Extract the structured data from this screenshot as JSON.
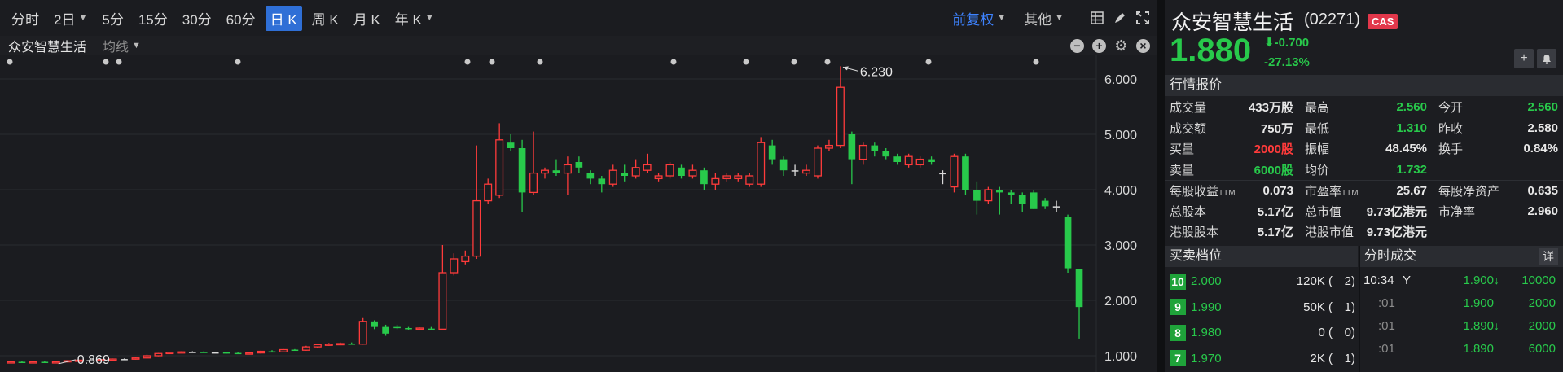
{
  "toolbar": {
    "periods": [
      {
        "label": "分时",
        "caret": false,
        "active": false
      },
      {
        "label": "2日",
        "caret": true,
        "active": false
      },
      {
        "label": "5分",
        "caret": false,
        "active": false
      },
      {
        "label": "15分",
        "caret": false,
        "active": false
      },
      {
        "label": "30分",
        "caret": false,
        "active": false
      },
      {
        "label": "60分",
        "caret": false,
        "active": false
      },
      {
        "label": "日 K",
        "caret": false,
        "active": true
      },
      {
        "label": "周 K",
        "caret": false,
        "active": false
      },
      {
        "label": "月 K",
        "caret": false,
        "active": false
      },
      {
        "label": "年 K",
        "caret": true,
        "active": false
      }
    ],
    "adjust_label": "前复权",
    "other_label": "其他",
    "icons": [
      "layout-grid-icon",
      "draw-pen-icon",
      "fullscreen-icon"
    ]
  },
  "series_bar": {
    "stock_name": "众安智慧生活",
    "ma_label": "均线",
    "icons": [
      "zoom-out-icon",
      "zoom-in-icon",
      "settings-icon",
      "close-icon"
    ]
  },
  "chart_data": {
    "type": "candlestick",
    "y_axis_labels": [
      "6.000",
      "5.000",
      "4.000",
      "3.000",
      "2.000",
      "1.000"
    ],
    "ylim": [
      0.9,
      6.3
    ],
    "max_label": "6.230",
    "min_label": "0.869",
    "colors": {
      "up": "#ff3b3b",
      "down": "#28c94b",
      "flat": "#d8d8d8"
    },
    "candles": [
      {
        "o": 0.88,
        "h": 0.9,
        "l": 0.87,
        "c": 0.89
      },
      {
        "o": 0.89,
        "h": 0.9,
        "l": 0.88,
        "c": 0.88
      },
      {
        "o": 0.88,
        "h": 0.89,
        "l": 0.87,
        "c": 0.89
      },
      {
        "o": 0.89,
        "h": 0.9,
        "l": 0.87,
        "c": 0.88
      },
      {
        "o": 0.88,
        "h": 0.89,
        "l": 0.869,
        "c": 0.89
      },
      {
        "o": 0.89,
        "h": 0.92,
        "l": 0.88,
        "c": 0.91
      },
      {
        "o": 0.91,
        "h": 0.93,
        "l": 0.9,
        "c": 0.92
      },
      {
        "o": 0.92,
        "h": 0.93,
        "l": 0.91,
        "c": 0.92
      },
      {
        "o": 0.92,
        "h": 0.94,
        "l": 0.91,
        "c": 0.93
      },
      {
        "o": 0.93,
        "h": 0.95,
        "l": 0.92,
        "c": 0.94
      },
      {
        "o": 0.94,
        "h": 0.95,
        "l": 0.93,
        "c": 0.94
      },
      {
        "o": 0.94,
        "h": 0.97,
        "l": 0.93,
        "c": 0.96
      },
      {
        "o": 0.96,
        "h": 1.02,
        "l": 0.95,
        "c": 1.0
      },
      {
        "o": 1.0,
        "h": 1.05,
        "l": 0.99,
        "c": 1.04
      },
      {
        "o": 1.04,
        "h": 1.07,
        "l": 1.03,
        "c": 1.06
      },
      {
        "o": 1.06,
        "h": 1.08,
        "l": 1.05,
        "c": 1.07
      },
      {
        "o": 1.07,
        "h": 1.08,
        "l": 1.06,
        "c": 1.07
      },
      {
        "o": 1.07,
        "h": 1.08,
        "l": 1.05,
        "c": 1.06
      },
      {
        "o": 1.06,
        "h": 1.07,
        "l": 1.05,
        "c": 1.06
      },
      {
        "o": 1.06,
        "h": 1.07,
        "l": 1.04,
        "c": 1.05
      },
      {
        "o": 1.05,
        "h": 1.06,
        "l": 1.03,
        "c": 1.04
      },
      {
        "o": 1.04,
        "h": 1.06,
        "l": 1.03,
        "c": 1.05
      },
      {
        "o": 1.05,
        "h": 1.09,
        "l": 1.04,
        "c": 1.08
      },
      {
        "o": 1.08,
        "h": 1.1,
        "l": 1.06,
        "c": 1.07
      },
      {
        "o": 1.07,
        "h": 1.12,
        "l": 1.06,
        "c": 1.11
      },
      {
        "o": 1.11,
        "h": 1.12,
        "l": 1.09,
        "c": 1.1
      },
      {
        "o": 1.1,
        "h": 1.18,
        "l": 1.09,
        "c": 1.16
      },
      {
        "o": 1.16,
        "h": 1.22,
        "l": 1.14,
        "c": 1.2
      },
      {
        "o": 1.2,
        "h": 1.23,
        "l": 1.18,
        "c": 1.21
      },
      {
        "o": 1.21,
        "h": 1.24,
        "l": 1.19,
        "c": 1.22
      },
      {
        "o": 1.22,
        "h": 1.24,
        "l": 1.2,
        "c": 1.21
      },
      {
        "o": 1.21,
        "h": 1.68,
        "l": 1.2,
        "c": 1.62
      },
      {
        "o": 1.62,
        "h": 1.64,
        "l": 1.48,
        "c": 1.52
      },
      {
        "o": 1.52,
        "h": 1.56,
        "l": 1.36,
        "c": 1.4
      },
      {
        "o": 1.52,
        "h": 1.56,
        "l": 1.48,
        "c": 1.5
      },
      {
        "o": 1.5,
        "h": 1.52,
        "l": 1.47,
        "c": 1.49
      },
      {
        "o": 1.49,
        "h": 1.51,
        "l": 1.47,
        "c": 1.5
      },
      {
        "o": 1.49,
        "h": 1.52,
        "l": 1.47,
        "c": 1.48
      },
      {
        "o": 1.48,
        "h": 3.0,
        "l": 1.47,
        "c": 2.5
      },
      {
        "o": 2.5,
        "h": 2.85,
        "l": 2.45,
        "c": 2.75
      },
      {
        "o": 2.7,
        "h": 2.9,
        "l": 2.65,
        "c": 2.8
      },
      {
        "o": 2.8,
        "h": 4.8,
        "l": 2.75,
        "c": 3.8
      },
      {
        "o": 3.8,
        "h": 4.2,
        "l": 3.75,
        "c": 4.1
      },
      {
        "o": 3.9,
        "h": 5.2,
        "l": 3.85,
        "c": 4.9
      },
      {
        "o": 4.85,
        "h": 5.0,
        "l": 4.7,
        "c": 4.75
      },
      {
        "o": 4.75,
        "h": 4.9,
        "l": 3.6,
        "c": 3.95
      },
      {
        "o": 3.95,
        "h": 5.05,
        "l": 3.9,
        "c": 4.3
      },
      {
        "o": 4.3,
        "h": 4.4,
        "l": 4.2,
        "c": 4.35
      },
      {
        "o": 4.35,
        "h": 4.55,
        "l": 4.25,
        "c": 4.3
      },
      {
        "o": 4.3,
        "h": 4.6,
        "l": 3.9,
        "c": 4.45
      },
      {
        "o": 4.5,
        "h": 4.6,
        "l": 4.3,
        "c": 4.4
      },
      {
        "o": 4.3,
        "h": 4.35,
        "l": 4.1,
        "c": 4.2
      },
      {
        "o": 4.2,
        "h": 4.25,
        "l": 3.95,
        "c": 4.1
      },
      {
        "o": 4.1,
        "h": 4.45,
        "l": 4.05,
        "c": 4.35
      },
      {
        "o": 4.3,
        "h": 4.45,
        "l": 4.15,
        "c": 4.25
      },
      {
        "o": 4.25,
        "h": 4.55,
        "l": 4.2,
        "c": 4.4
      },
      {
        "o": 4.35,
        "h": 4.65,
        "l": 4.3,
        "c": 4.45
      },
      {
        "o": 4.2,
        "h": 4.3,
        "l": 4.15,
        "c": 4.25
      },
      {
        "o": 4.25,
        "h": 4.5,
        "l": 4.2,
        "c": 4.45
      },
      {
        "o": 4.4,
        "h": 4.45,
        "l": 4.2,
        "c": 4.25
      },
      {
        "o": 4.25,
        "h": 4.45,
        "l": 4.2,
        "c": 4.35
      },
      {
        "o": 4.35,
        "h": 4.4,
        "l": 4.0,
        "c": 4.1
      },
      {
        "o": 4.1,
        "h": 4.3,
        "l": 4.0,
        "c": 4.2
      },
      {
        "o": 4.2,
        "h": 4.3,
        "l": 4.15,
        "c": 4.25
      },
      {
        "o": 4.2,
        "h": 4.3,
        "l": 4.15,
        "c": 4.25
      },
      {
        "o": 4.1,
        "h": 4.3,
        "l": 4.05,
        "c": 4.25
      },
      {
        "o": 4.1,
        "h": 4.95,
        "l": 4.05,
        "c": 4.85
      },
      {
        "o": 4.8,
        "h": 4.9,
        "l": 4.45,
        "c": 4.55
      },
      {
        "o": 4.55,
        "h": 4.6,
        "l": 4.25,
        "c": 4.35
      },
      {
        "o": 4.35,
        "h": 4.45,
        "l": 4.25,
        "c": 4.35
      },
      {
        "o": 4.3,
        "h": 4.45,
        "l": 4.25,
        "c": 4.35
      },
      {
        "o": 4.25,
        "h": 4.8,
        "l": 4.2,
        "c": 4.75
      },
      {
        "o": 4.75,
        "h": 4.9,
        "l": 4.7,
        "c": 4.8
      },
      {
        "o": 4.8,
        "h": 6.23,
        "l": 4.75,
        "c": 5.85
      },
      {
        "o": 5.0,
        "h": 5.05,
        "l": 4.1,
        "c": 4.55
      },
      {
        "o": 4.55,
        "h": 4.85,
        "l": 4.45,
        "c": 4.8
      },
      {
        "o": 4.8,
        "h": 4.85,
        "l": 4.6,
        "c": 4.7
      },
      {
        "o": 4.7,
        "h": 4.75,
        "l": 4.55,
        "c": 4.6
      },
      {
        "o": 4.6,
        "h": 4.65,
        "l": 4.45,
        "c": 4.5
      },
      {
        "o": 4.45,
        "h": 4.65,
        "l": 4.4,
        "c": 4.6
      },
      {
        "o": 4.45,
        "h": 4.6,
        "l": 4.4,
        "c": 4.55
      },
      {
        "o": 4.55,
        "h": 4.6,
        "l": 4.45,
        "c": 4.5
      },
      {
        "o": 4.3,
        "h": 4.35,
        "l": 4.1,
        "c": 4.3
      },
      {
        "o": 4.05,
        "h": 4.65,
        "l": 3.95,
        "c": 4.6
      },
      {
        "o": 4.6,
        "h": 4.65,
        "l": 3.9,
        "c": 4.0
      },
      {
        "o": 4.0,
        "h": 4.15,
        "l": 3.55,
        "c": 3.8
      },
      {
        "o": 3.8,
        "h": 4.05,
        "l": 3.75,
        "c": 4.0
      },
      {
        "o": 4.0,
        "h": 4.05,
        "l": 3.55,
        "c": 3.95
      },
      {
        "o": 3.95,
        "h": 4.0,
        "l": 3.75,
        "c": 3.9
      },
      {
        "o": 3.9,
        "h": 3.95,
        "l": 3.6,
        "c": 3.75
      },
      {
        "o": 3.95,
        "h": 4.0,
        "l": 3.65,
        "c": 3.65
      },
      {
        "o": 3.8,
        "h": 3.85,
        "l": 3.65,
        "c": 3.7
      },
      {
        "o": 3.7,
        "h": 3.8,
        "l": 3.6,
        "c": 3.7
      },
      {
        "o": 3.5,
        "h": 3.55,
        "l": 2.5,
        "c": 2.58
      },
      {
        "o": 2.56,
        "h": 2.56,
        "l": 1.31,
        "c": 1.88
      }
    ],
    "top_dots": [
      12,
      130,
      146,
      292,
      574,
      604,
      663,
      827,
      916,
      975,
      1016,
      1140,
      1272
    ]
  },
  "quote": {
    "name": "众安智慧生活",
    "code": "(02271)",
    "badge": "CAS",
    "price": "1.880",
    "change": "-0.700",
    "change_pct": "-27.13%",
    "actions": [
      "add-watch-icon",
      "alert-bell-icon"
    ],
    "section_title": "行情报价",
    "rows": [
      [
        {
          "l": "成交量",
          "v": "433万股",
          "c": "white"
        },
        {
          "l": "最高",
          "v": "2.560",
          "c": "green"
        },
        {
          "l": "今开",
          "v": "2.560",
          "c": "green"
        }
      ],
      [
        {
          "l": "成交额",
          "v": "750万",
          "c": "white"
        },
        {
          "l": "最低",
          "v": "1.310",
          "c": "green"
        },
        {
          "l": "昨收",
          "v": "2.580",
          "c": "white"
        }
      ],
      [
        {
          "l": "买量",
          "v": "2000股",
          "c": "red"
        },
        {
          "l": "振幅",
          "v": "48.45%",
          "c": "white"
        },
        {
          "l": "换手",
          "v": "0.84%",
          "c": "white"
        }
      ],
      [
        {
          "l": "卖量",
          "v": "6000股",
          "c": "green"
        },
        {
          "l": "均价",
          "v": "1.732",
          "c": "green"
        },
        {
          "l": "",
          "v": "",
          "c": "white"
        }
      ]
    ],
    "rows2": [
      [
        {
          "l": "每股收益",
          "sub": "TTM",
          "v": "0.073"
        },
        {
          "l": "市盈率",
          "sub": "TTM",
          "v": "25.67"
        },
        {
          "l": "每股净资产",
          "sub": "",
          "v": "0.635"
        }
      ],
      [
        {
          "l": "总股本",
          "sub": "",
          "v": "5.17亿"
        },
        {
          "l": "总市值",
          "sub": "",
          "v": "9.73亿港元"
        },
        {
          "l": "市净率",
          "sub": "",
          "v": "2.960"
        }
      ],
      [
        {
          "l": "港股股本",
          "sub": "",
          "v": "5.17亿"
        },
        {
          "l": "港股市值",
          "sub": "",
          "v": "9.73亿港元"
        },
        {
          "l": "",
          "sub": "",
          "v": ""
        }
      ]
    ]
  },
  "depth": {
    "title": "买卖档位",
    "levels": [
      {
        "lvl": "10",
        "price": "2.000",
        "vol": "120K (",
        "cnt": "2)"
      },
      {
        "lvl": "9",
        "price": "1.990",
        "vol": "50K (",
        "cnt": "1)"
      },
      {
        "lvl": "8",
        "price": "1.980",
        "vol": "0 (",
        "cnt": "0)"
      },
      {
        "lvl": "7",
        "price": "1.970",
        "vol": "2K (",
        "cnt": "1)"
      }
    ]
  },
  "ticks": {
    "title": "分时成交",
    "detail_label": "详",
    "rows": [
      {
        "time": "10:34",
        "flag": "Y",
        "price": "1.900",
        "arrow": "↓",
        "vol": "10000",
        "dim": false
      },
      {
        "time": ":01",
        "flag": "",
        "price": "1.900",
        "arrow": "",
        "vol": "2000",
        "dim": true
      },
      {
        "time": ":01",
        "flag": "",
        "price": "1.890",
        "arrow": "↓",
        "vol": "2000",
        "dim": true
      },
      {
        "time": ":01",
        "flag": "",
        "price": "1.890",
        "arrow": "",
        "vol": "6000",
        "dim": true
      }
    ]
  }
}
